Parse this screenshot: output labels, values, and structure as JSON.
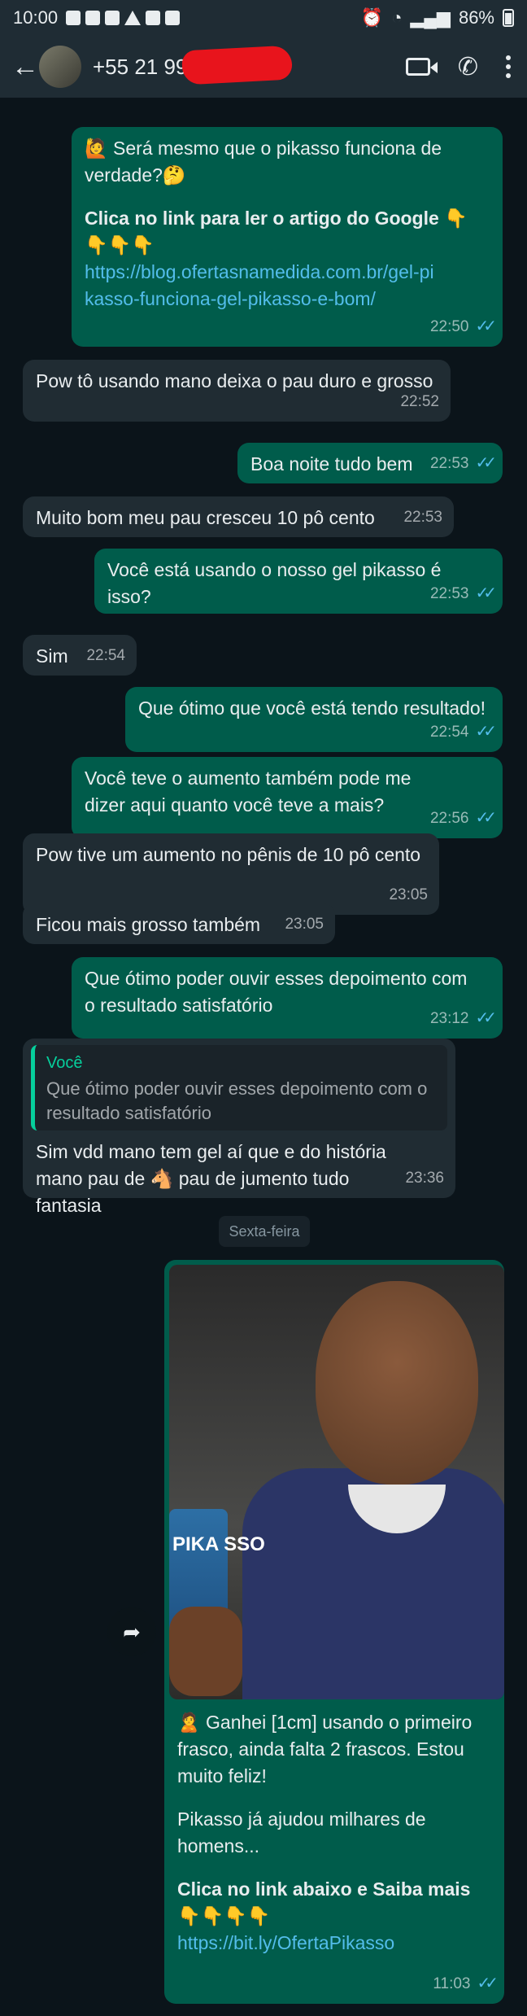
{
  "status_bar": {
    "time": "10:00",
    "battery": "86%"
  },
  "header": {
    "contact": "+55 21 99"
  },
  "day_separator": "Sexta-feira",
  "messages": [
    {
      "p1": "🙋 Será mesmo que o pikasso funciona de verdade?🤔",
      "p2": "Clica no link para ler o artigo do Google 👇👇👇👇",
      "link": "https://blog.ofertasnamedida.com.br/gel-pikasso-funciona-gel-pikasso-e-bom/",
      "time": "22:50"
    },
    {
      "text": "Pow tô usando mano deixa o pau duro e grosso",
      "time": "22:52"
    },
    {
      "text": "Boa noite tudo bem",
      "time": "22:53"
    },
    {
      "text": "Muito bom meu pau cresceu 10 pô cento",
      "time": "22:53"
    },
    {
      "text": "Você está usando o nosso gel pikasso é isso?",
      "time": "22:53"
    },
    {
      "text": "Sim",
      "time": "22:54"
    },
    {
      "text": "Que ótimo que você está tendo resultado!",
      "time": "22:54"
    },
    {
      "text": "Você teve o aumento também pode me dizer aqui quanto você teve a mais?",
      "time": "22:56"
    },
    {
      "text": "Pow tive um aumento no pênis de 10 pô cento",
      "time": "23:05"
    },
    {
      "text": "Ficou mais grosso também",
      "time": "23:05"
    },
    {
      "text": "Que ótimo poder ouvir esses depoimento com o resultado satisfatório",
      "time": "23:12"
    },
    {
      "quote_author": "Você",
      "quote_text": "Que ótimo poder ouvir esses depoimento com o resultado satisfatório",
      "text": "Sim vdd mano tem gel aí que e do história mano pau de 🐴 pau de jumento tudo fantasia",
      "time": "23:36"
    },
    {
      "photo_text": "PIKA SSO",
      "p1": "🙎 Ganhei [1cm] usando o primeiro frasco, ainda falta 2 frascos. Estou muito feliz!",
      "p2": "Pikasso já ajudou milhares de homens...",
      "p3": "Clica no link abaixo e Saiba mais 👇👇👇👇",
      "link": "https://bit.ly/OfertaPikasso",
      "time": "11:03"
    }
  ]
}
